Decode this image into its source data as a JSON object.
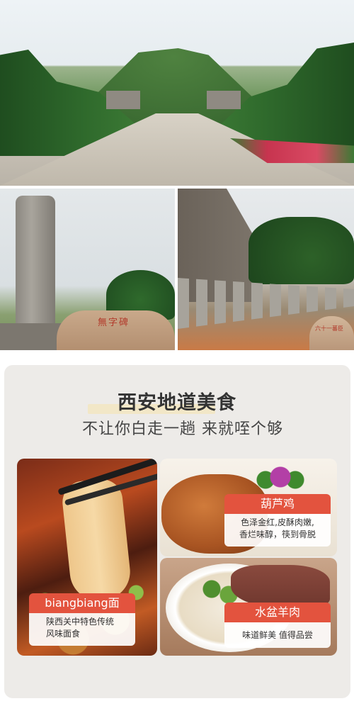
{
  "photos": {
    "stele_rock": {
      "title": "無字碑",
      "caption": "无字碑"
    },
    "statue_rock": {
      "title": "六十一蕃臣",
      "caption": "六十一蕃臣像"
    }
  },
  "food_section": {
    "title": "西安地道美食",
    "subtitle": "不让你白走一趟 来就咥个够",
    "accent_color": "#e3533e",
    "items": [
      {
        "name": "biangbiang面",
        "desc_line1": "陕西关中特色传统",
        "desc_line2": "风味面食"
      },
      {
        "name": "葫芦鸡",
        "desc_line1": "色泽金红,皮酥肉嫩,",
        "desc_line2": "香烂味醇，筷到骨脱"
      },
      {
        "name": "水盆羊肉",
        "desc_line1": "味道鲜美 值得品尝"
      }
    ]
  }
}
